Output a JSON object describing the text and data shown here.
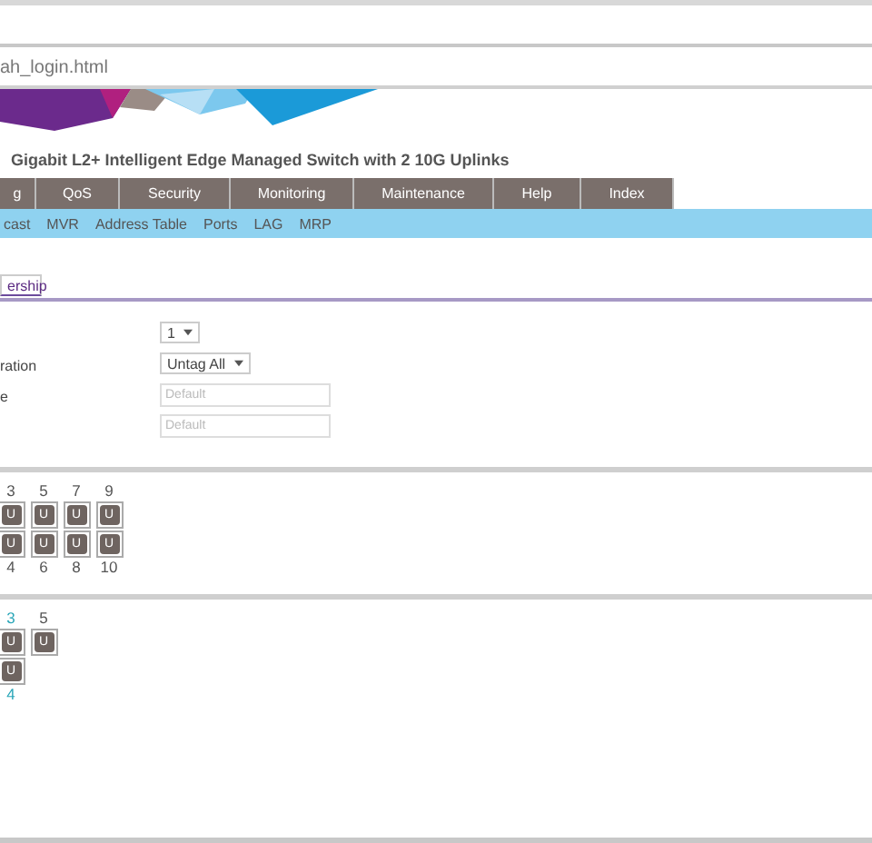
{
  "address_bar": {
    "url": "ah_login.html"
  },
  "product_title": "Gigabit L2+ Intelligent Edge Managed Switch with 2 10G Uplinks",
  "main_menu": [
    {
      "label": "g",
      "selected": false
    },
    {
      "label": "QoS",
      "selected": false
    },
    {
      "label": "Security",
      "selected": false
    },
    {
      "label": "Monitoring",
      "selected": false
    },
    {
      "label": "Maintenance",
      "selected": false
    },
    {
      "label": "Help",
      "selected": false
    },
    {
      "label": "Index",
      "selected": false
    }
  ],
  "sub_menu": [
    {
      "label": "cast",
      "selected": false
    },
    {
      "label": "MVR",
      "selected": false
    },
    {
      "label": "Address Table",
      "selected": false
    },
    {
      "label": "Ports",
      "selected": false
    },
    {
      "label": "LAG",
      "selected": false
    },
    {
      "label": "MRP",
      "selected": false
    }
  ],
  "section_tab": {
    "label": "ership",
    "selected": true
  },
  "form": [
    {
      "kind": "select",
      "value": "1"
    },
    {
      "kind": "select",
      "label": "ration",
      "value": "Untag All"
    },
    {
      "kind": "input",
      "label": "e",
      "placeholder": "Default"
    },
    {
      "kind": "input",
      "placeholder": "Default"
    }
  ],
  "port_groups": [
    {
      "columns": [
        {
          "top": {
            "text": "3",
            "color": "#555555"
          },
          "cells": [
            "U",
            "U"
          ],
          "bottom": {
            "text": "4",
            "color": "#555555"
          }
        },
        {
          "top": {
            "text": "5",
            "color": "#555555"
          },
          "cells": [
            "U",
            "U"
          ],
          "bottom": {
            "text": "6",
            "color": "#555555"
          }
        },
        {
          "top": {
            "text": "7",
            "color": "#555555"
          },
          "cells": [
            "U",
            "U"
          ],
          "bottom": {
            "text": "8",
            "color": "#555555"
          }
        },
        {
          "top": {
            "text": "9",
            "color": "#555555"
          },
          "cells": [
            "U",
            "U"
          ],
          "bottom": {
            "text": "10",
            "color": "#555555"
          }
        }
      ]
    },
    {
      "columns": [
        {
          "top": {
            "text": "3",
            "color": "#2aa6b8"
          },
          "cells": [
            "U",
            "U"
          ],
          "bottom": {
            "text": "4",
            "color": "#2aa6b8"
          }
        },
        {
          "top": {
            "text": "5",
            "color": "#555555"
          },
          "cells": [
            "U"
          ]
        }
      ]
    }
  ]
}
